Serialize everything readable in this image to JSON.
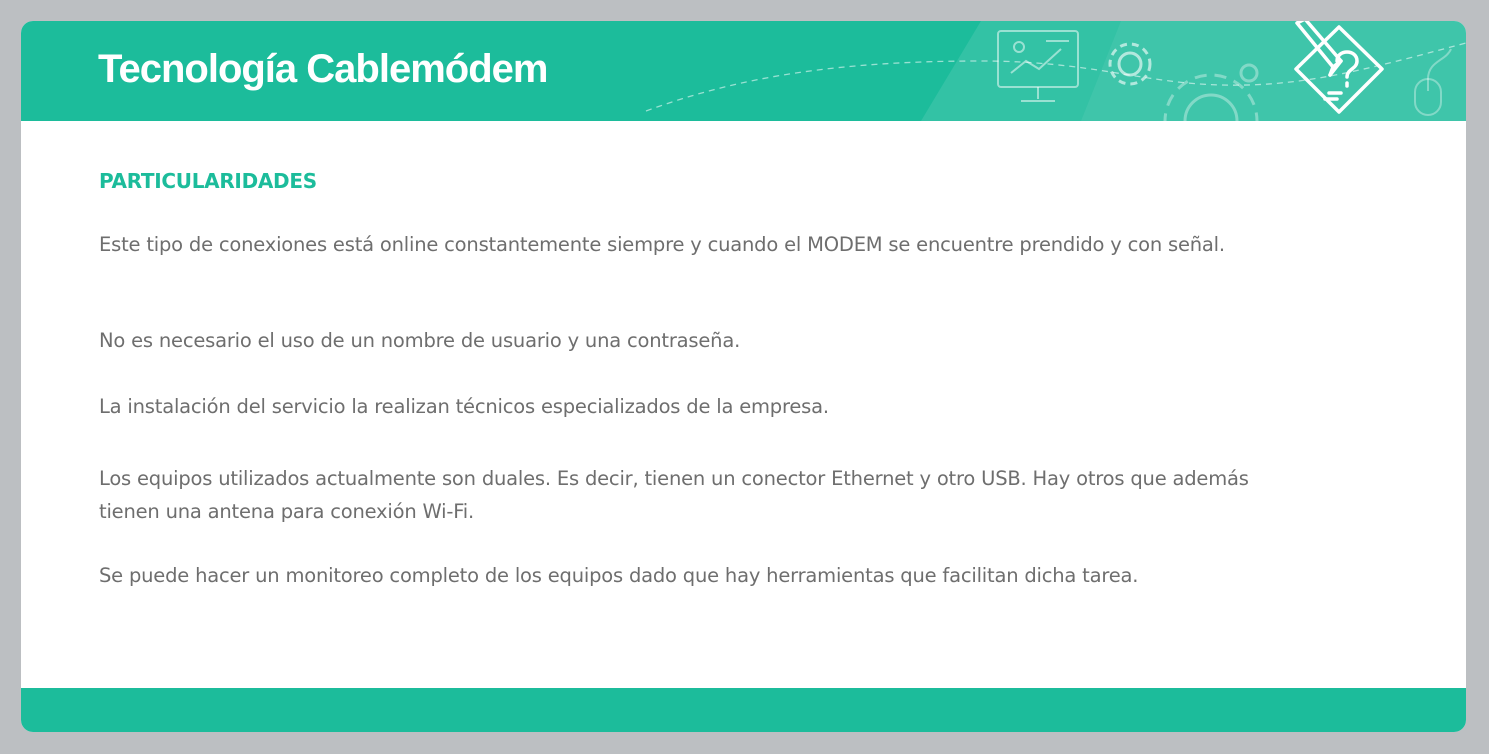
{
  "header": {
    "title": "Tecnología Cablemódem",
    "decor_icons": [
      "presentation-board-icon",
      "gear-icon",
      "large-gear-icon",
      "mouse-icon",
      "pencil-diamond-icon"
    ]
  },
  "content": {
    "heading": "PARTICULARIDADES",
    "paragraphs": [
      "Este tipo de conexiones está online constantemente siempre y cuando el MODEM se encuentre prendido y con señal.",
      "No es necesario el uso de un nombre de usuario y una contraseña.",
      "La instalación del servicio la realizan técnicos especializados de la empresa.",
      "Los equipos utilizados actualmente son duales. Es decir, tienen un conector Ethernet y otro USB. Hay otros que además tienen una antena para conexión Wi-Fi.",
      "Se puede hacer un monitoreo completo de los equipos dado que hay herramientas que facilitan dicha tarea."
    ]
  },
  "colors": {
    "accent": "#1cbc9b",
    "text": "#6e6e6e",
    "background": "#bcbfc2",
    "card": "#ffffff"
  }
}
